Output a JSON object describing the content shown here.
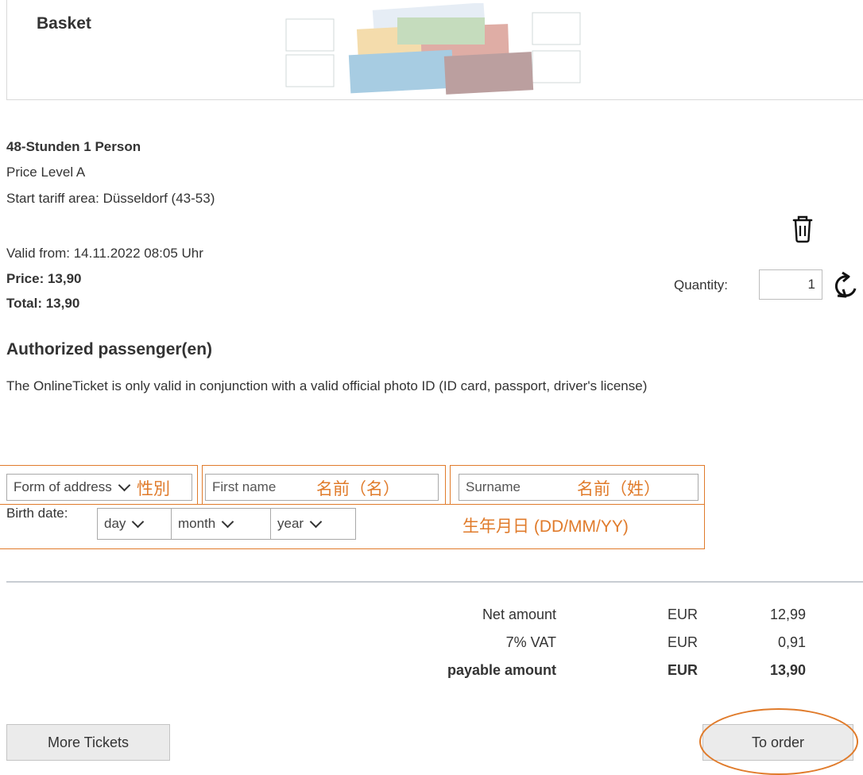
{
  "banner": {
    "title": "Basket"
  },
  "ticket": {
    "name": "48-Stunden 1 Person",
    "price_level": "Price Level A",
    "tariff_area": "Start tariff area: Düsseldorf (43-53)",
    "valid_from": "Valid from: 14.11.2022 08:05 Uhr",
    "price": "Price: 13,90",
    "total": "Total: 13,90",
    "quantity_label": "Quantity:",
    "quantity_value": "1"
  },
  "passenger": {
    "title": "Authorized passenger(en)",
    "note": "The OnlineTicket is only valid in conjunction with a valid official photo ID (ID card, passport, driver's license)",
    "form_of_address": "Form of address",
    "first_name_placeholder": "First name",
    "surname_placeholder": "Surname",
    "birth_label": "Birth date:",
    "day": "day",
    "month": "month",
    "year": "year"
  },
  "annotations": {
    "address": "性別",
    "first_name": "名前（名）",
    "surname": "名前（姓）",
    "birth": "生年月日 (DD/MM/YY)",
    "color": "#e07b2b"
  },
  "totals": {
    "rows": [
      {
        "label": "Net amount",
        "currency": "EUR",
        "value": "12,99"
      },
      {
        "label": "7% VAT",
        "currency": "EUR",
        "value": "0,91"
      },
      {
        "label": "payable amount",
        "currency": "EUR",
        "value": "13,90"
      }
    ]
  },
  "buttons": {
    "more_tickets": "More Tickets",
    "to_order": "To order"
  },
  "icons": {
    "delete": "trash-icon",
    "refresh": "refresh-icon",
    "select": "chevron-down-icon"
  }
}
